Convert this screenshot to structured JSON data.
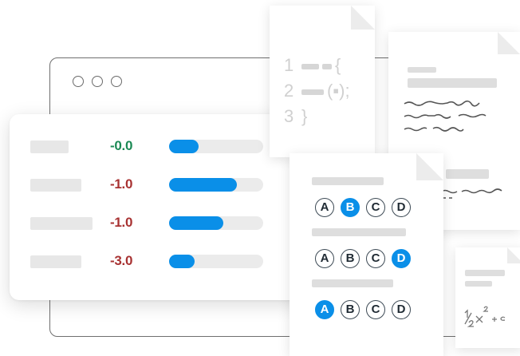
{
  "scores": [
    {
      "value": "-0.0",
      "color": "#1c8a55",
      "fill_fraction": 0.31
    },
    {
      "value": "-1.0",
      "color": "#a83232",
      "fill_fraction": 0.72
    },
    {
      "value": "-1.0",
      "color": "#a83232",
      "fill_fraction": 0.58
    },
    {
      "value": "-3.0",
      "color": "#a83232",
      "fill_fraction": 0.27
    }
  ],
  "code_doc": {
    "lines": [
      {
        "num": "1",
        "suffix": "{"
      },
      {
        "num": "2",
        "suffix": "(▪);"
      },
      {
        "num": "3",
        "suffix": "}"
      }
    ]
  },
  "quiz": {
    "options": [
      "A",
      "B",
      "C",
      "D"
    ],
    "questions": [
      {
        "selected": "B"
      },
      {
        "selected": "D"
      },
      {
        "selected": "A"
      }
    ]
  },
  "colors": {
    "accent": "#0a8fe8",
    "positive": "#1c8a55",
    "negative": "#a83232"
  }
}
